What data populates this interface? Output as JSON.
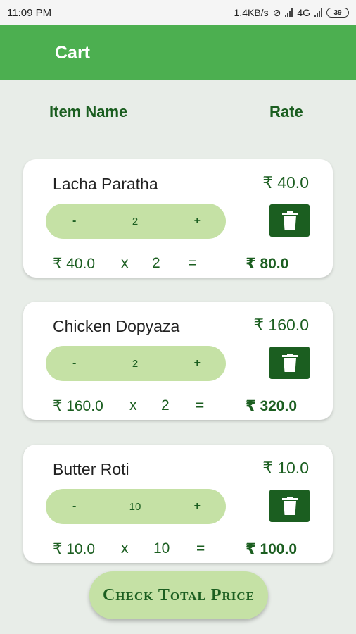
{
  "status_bar": {
    "time": "11:09 PM",
    "net_speed": "1.4KB/s",
    "network": "4G",
    "battery": "39"
  },
  "app_bar": {
    "title": "Cart"
  },
  "header": {
    "item_name": "Item Name",
    "rate": "Rate"
  },
  "items": [
    {
      "name": "Lacha Paratha",
      "rate": "₹ 40.0",
      "minus": "-",
      "qty": "2",
      "plus": "+",
      "unit": "₹ 40.0",
      "x": "x",
      "eq": "=",
      "total": "₹ 80.0"
    },
    {
      "name": "Chicken Dopyaza",
      "rate": "₹ 160.0",
      "minus": "-",
      "qty": "2",
      "plus": "+",
      "unit": "₹ 160.0",
      "x": "x",
      "eq": "=",
      "total": "₹ 320.0"
    },
    {
      "name": "Butter Roti",
      "rate": "₹ 10.0",
      "minus": "-",
      "qty": "10",
      "plus": "+",
      "unit": "₹ 10.0",
      "x": "x",
      "eq": "=",
      "total": "₹ 100.0"
    }
  ],
  "check_button": {
    "label": "Check Total Price"
  },
  "colors": {
    "primary": "#4caf50",
    "dark": "#1b5e20",
    "light": "#c5e1a5",
    "background": "#e8ede8"
  },
  "icons": {
    "delete": "trash-icon"
  }
}
